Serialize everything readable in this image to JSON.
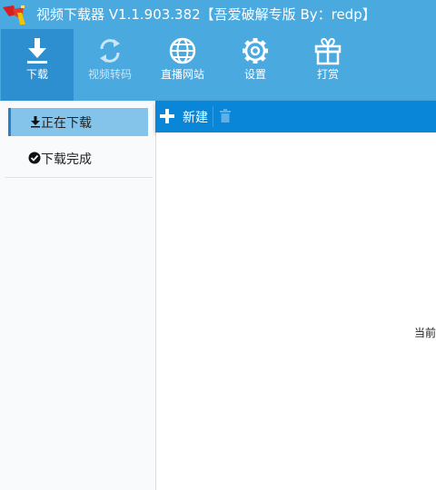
{
  "window": {
    "title": "视频下载器 V1.1.903.382【吾爱破解专版 By：redp】"
  },
  "toolbar": {
    "items": [
      {
        "label": "下载",
        "icon": "download-icon"
      },
      {
        "label": "视频转码",
        "icon": "refresh-icon"
      },
      {
        "label": "直播网站",
        "icon": "globe-icon"
      },
      {
        "label": "设置",
        "icon": "gear-icon"
      },
      {
        "label": "打赏",
        "icon": "gift-icon"
      }
    ]
  },
  "sidebar": {
    "items": [
      {
        "label": "正在下载",
        "icon": "download-small-icon"
      },
      {
        "label": "下载完成",
        "icon": "check-circle-icon"
      }
    ]
  },
  "actions": {
    "new_label": "新建"
  },
  "main": {
    "status_text": "当前"
  },
  "colors": {
    "header": "#4aa9df",
    "active_tab": "#2d8fd0",
    "action_bar": "#0a86d8",
    "selected_nav": "#85c4ea"
  }
}
